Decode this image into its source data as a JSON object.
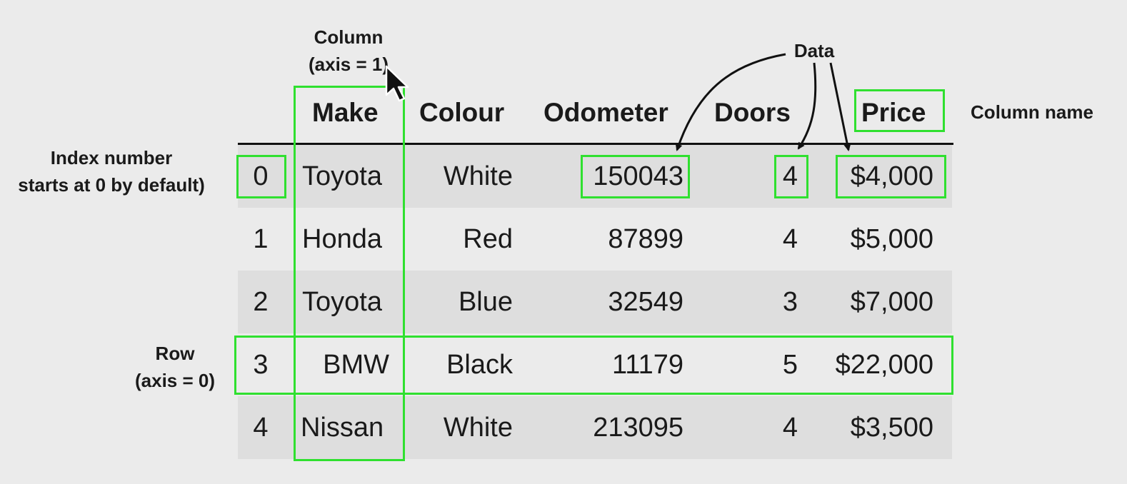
{
  "annotations": {
    "column_label": [
      "Column",
      "(axis = 1)"
    ],
    "data_label": "Data",
    "column_name_label": "Column name",
    "index_label": [
      "Index number",
      "starts at 0 by default)"
    ],
    "row_label": [
      "Row",
      "(axis = 0)"
    ]
  },
  "table": {
    "headers": [
      "Make",
      "Colour",
      "Odometer",
      "Doors",
      "Price"
    ],
    "rows": [
      {
        "index": "0",
        "make": "Toyota",
        "colour": "White",
        "odometer": "150043",
        "doors": "4",
        "price": "$4,000"
      },
      {
        "index": "1",
        "make": "Honda",
        "colour": "Red",
        "odometer": "87899",
        "doors": "4",
        "price": "$5,000"
      },
      {
        "index": "2",
        "make": "Toyota",
        "colour": "Blue",
        "odometer": "32549",
        "doors": "3",
        "price": "$7,000"
      },
      {
        "index": "3",
        "make": "BMW",
        "colour": "Black",
        "odometer": "11179",
        "doors": "5",
        "price": "$22,000"
      },
      {
        "index": "4",
        "make": "Nissan",
        "colour": "White",
        "odometer": "213095",
        "doors": "4",
        "price": "$3,500"
      }
    ]
  },
  "colors": {
    "highlight": "#2fe02f",
    "striped_row": "#dedede",
    "background": "#ebebeb"
  },
  "icons": [
    "mouse-cursor-icon",
    "arrow-icon"
  ]
}
